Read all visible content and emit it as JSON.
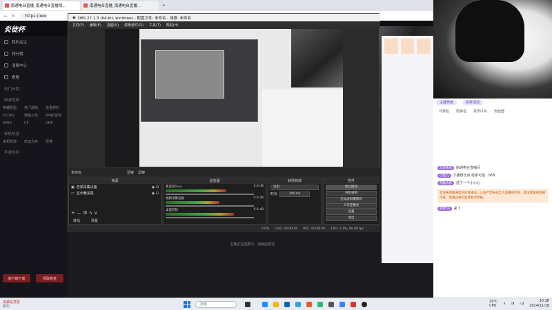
{
  "browser": {
    "tabs": [
      {
        "title": "南通电台直播_南通电台直播视..."
      },
      {
        "title": "南通电台直播_南通电台直播..."
      }
    ],
    "url": "https://www.d",
    "site_logo": "炎徒杯",
    "sidebar": {
      "items": [
        "我的关注",
        "排行榜",
        "消费中心",
        "看看"
      ],
      "section_titles": [
        "热门分类",
        "网游竞技",
        "单机热游",
        "手游休闲"
      ],
      "grid": [
        [
          "英雄联盟",
          "热门游戏",
          "无畏契约"
        ],
        [
          "DOTA2",
          "穿越火线",
          "WWE游戏"
        ],
        [
          "APEX",
          "CF",
          "DNF"
        ],
        [
          "单机热游",
          "命运方舟",
          "原神"
        ]
      ],
      "buttons": [
        "客户端下载",
        "领取黄金"
      ]
    }
  },
  "obs": {
    "title": "OBS 27.1.3 (64-bit, windows) - 配置文件: 未命名 - 场景: 未命名",
    "menu": [
      "文件(F)",
      "编辑(E)",
      "视图(V)",
      "停靠部件(D)",
      "工具(T)",
      "帮助(H)"
    ],
    "scene_bar": {
      "label": "未命名",
      "btn1": "滤镜",
      "btn2": "滤镜"
    },
    "sources": {
      "header": "来源",
      "items": [
        "音频采集设备",
        "显示器采集"
      ],
      "footer": [
        "转场",
        "场景"
      ]
    },
    "mixer": {
      "header": "混音器",
      "channels": [
        {
          "name": "麦克风/Aux",
          "db": "0.0 dB",
          "level": 0.62
        },
        {
          "name": "视频采集设备",
          "db": "0.0 dB",
          "level": 0.55
        },
        {
          "name": "桌面音频",
          "db": "0.0 dB",
          "level": 0.7
        }
      ]
    },
    "transitions": {
      "header": "转场特效",
      "type": "淡出",
      "duration_label": "时长",
      "duration": "300 ms"
    },
    "controls": {
      "header": "控件",
      "buttons": [
        "停止推流",
        "开始录制",
        "启动虚拟摄像机",
        "工作室模式",
        "设置",
        "退出"
      ]
    },
    "status": {
      "dropped": "0.0%",
      "live": "LIVE: 00:00:00",
      "rec": "REC: 00:00:00",
      "cpu_fps": "CPU: 5.1%, 60.00 fps"
    }
  },
  "screenshare_label": "主播正在连麦中，请稍后尝试",
  "chat": {
    "top_pills": [
      "主播贡献",
      "贵族活动"
    ],
    "tabs": [
      "日排名",
      "周排名",
      "贵宾(16)",
      "粉丝团"
    ],
    "lines": [
      {
        "user": "欢迎来到",
        "text": "南通电台直播间"
      },
      {
        "user": "小鱼儿",
        "text": "下播想玩点·给家可能 · 868"
      },
      {
        "user": "无敌大将",
        "text": "送了一个小心心"
      },
      {
        "user": "游客56",
        "text": "来了"
      }
    ],
    "announcement": "欢迎来到南通电台的直播间，斗鱼严禁未成年人直播或打赏，请注意甄别直播内容，如遇违规内容请及时举报。"
  },
  "taskbar": {
    "weather_title": "来都是意愿",
    "weather_sub": "阴天",
    "search_placeholder": "搜索",
    "temp": "29°C",
    "temp_sub": "CPU",
    "time": "20:38",
    "date": "2024/11/18"
  }
}
